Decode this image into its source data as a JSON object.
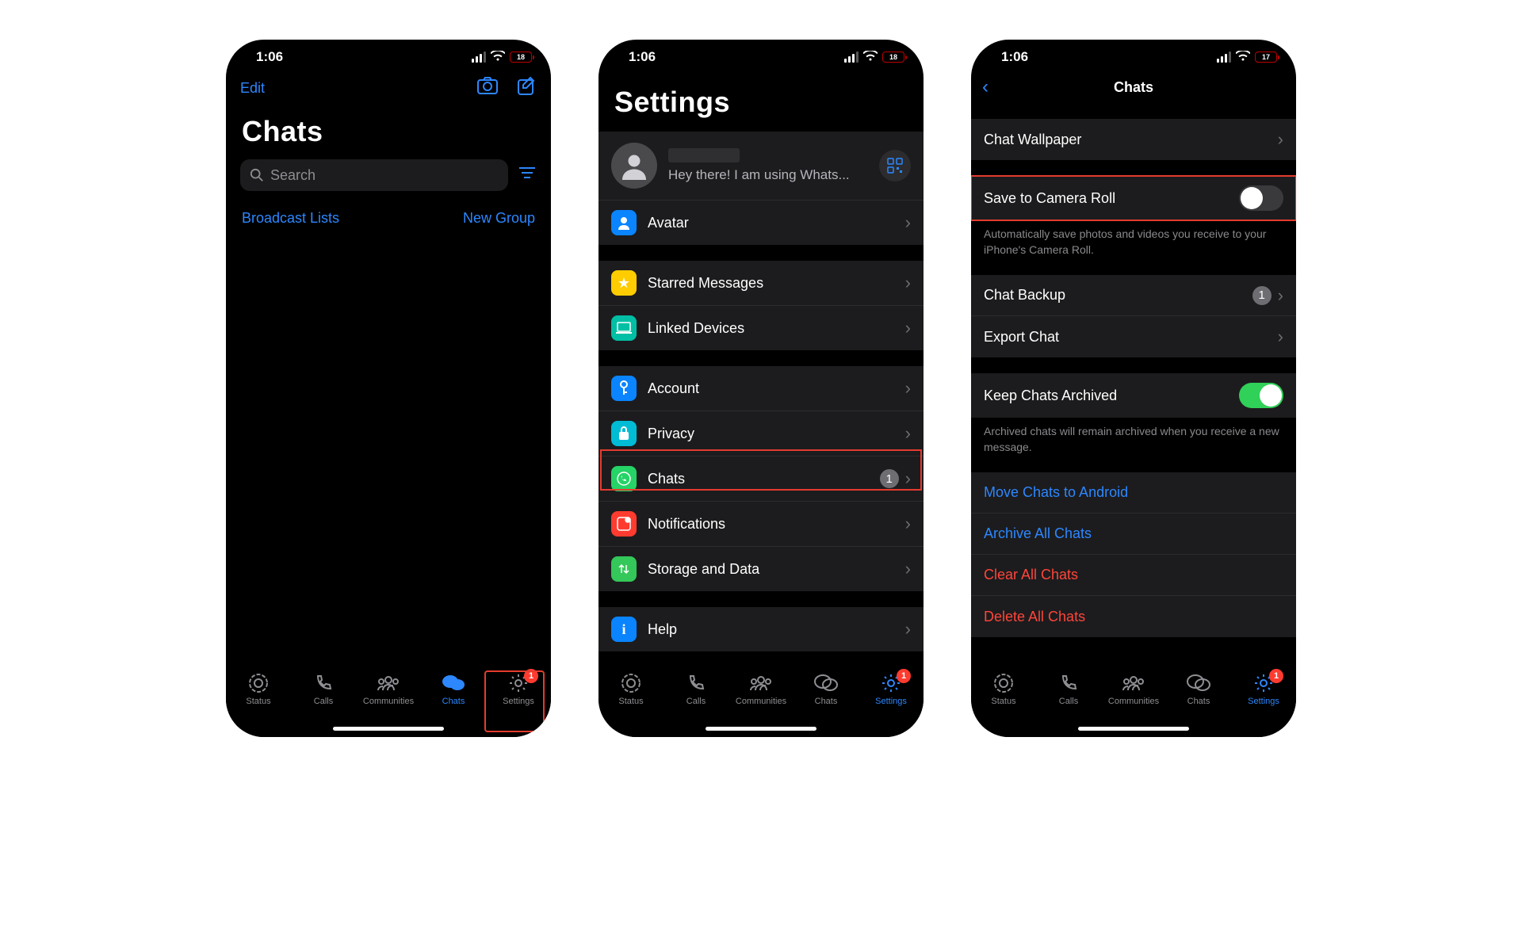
{
  "statusbar": {
    "time": "1:06",
    "battery_pct": "18",
    "battery_pct_s3": "17"
  },
  "screen1": {
    "edit": "Edit",
    "title": "Chats",
    "search_placeholder": "Search",
    "broadcast": "Broadcast Lists",
    "newgroup": "New Group",
    "tabs": {
      "status": "Status",
      "calls": "Calls",
      "communities": "Communities",
      "chats": "Chats",
      "settings": "Settings",
      "badge": "1"
    }
  },
  "screen2": {
    "title": "Settings",
    "profile_status": "Hey there! I am using Whats...",
    "avatar": "Avatar",
    "starred": "Starred Messages",
    "linked": "Linked Devices",
    "account": "Account",
    "privacy": "Privacy",
    "chats": "Chats",
    "chats_badge": "1",
    "notifications": "Notifications",
    "storage": "Storage and Data",
    "help": "Help",
    "tabs": {
      "status": "Status",
      "calls": "Calls",
      "communities": "Communities",
      "chats": "Chats",
      "settings": "Settings",
      "badge": "1"
    }
  },
  "screen3": {
    "title": "Chats",
    "wallpaper": "Chat Wallpaper",
    "save_camera": "Save to Camera Roll",
    "save_camera_footer": "Automatically save photos and videos you receive to your iPhone's Camera Roll.",
    "backup": "Chat Backup",
    "backup_badge": "1",
    "export": "Export Chat",
    "keep_archived": "Keep Chats Archived",
    "keep_archived_footer": "Archived chats will remain archived when you receive a new message.",
    "move_android": "Move Chats to Android",
    "archive_all": "Archive All Chats",
    "clear_all": "Clear All Chats",
    "delete_all": "Delete All Chats",
    "tabs": {
      "status": "Status",
      "calls": "Calls",
      "communities": "Communities",
      "chats": "Chats",
      "settings": "Settings",
      "badge": "1"
    }
  }
}
